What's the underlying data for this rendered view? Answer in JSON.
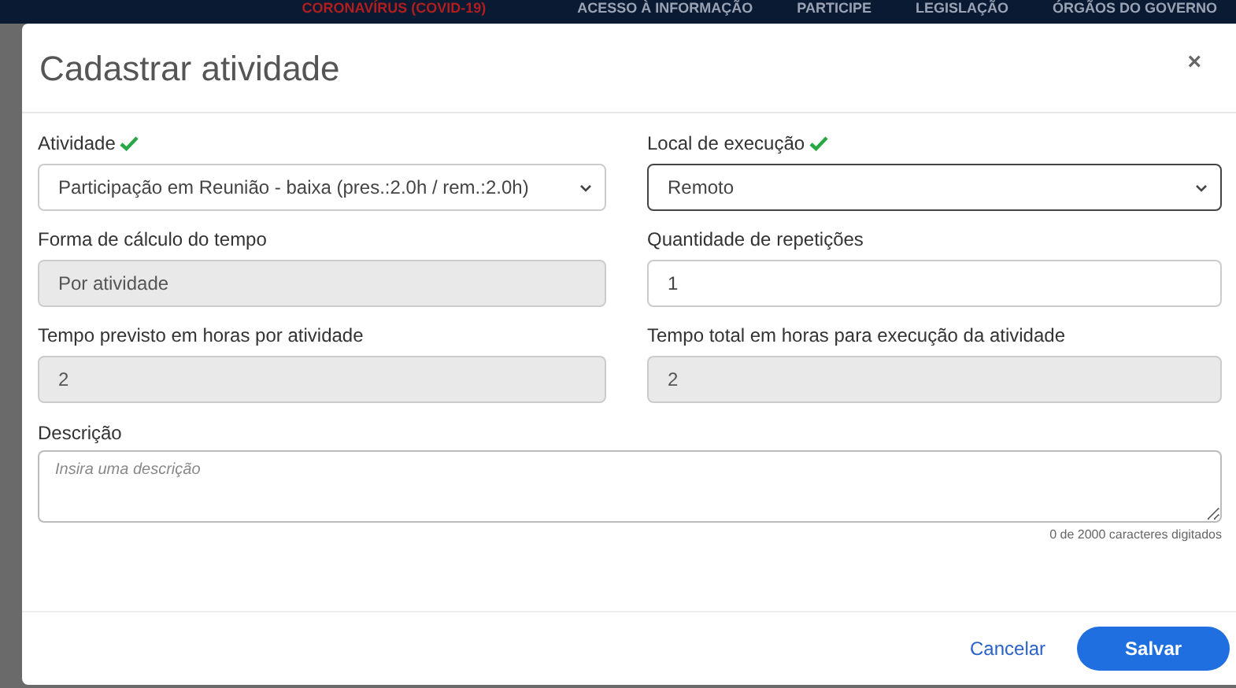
{
  "top_bar": {
    "links": [
      {
        "label": "CORONAVÍRUS (COVID-19)",
        "kind": "alert"
      },
      {
        "label": "ACESSO À INFORMAÇÃO",
        "kind": "normal"
      },
      {
        "label": "PARTICIPE",
        "kind": "normal"
      },
      {
        "label": "LEGISLAÇÃO",
        "kind": "normal"
      },
      {
        "label": "ÓRGÃOS DO GOVERNO",
        "kind": "normal"
      }
    ]
  },
  "dialog": {
    "title": "Cadastrar atividade",
    "close": "×",
    "fields": [
      {
        "kind": "select",
        "label": "Atividade",
        "valid": true,
        "value": "Participação em Reunião - baixa (pres.:2.0h / rem.:2.0h)",
        "disabled": false,
        "focused": false
      },
      {
        "kind": "select",
        "label": "Local de execução",
        "valid": true,
        "value": "Remoto",
        "disabled": false,
        "focused": true
      },
      {
        "kind": "input",
        "label": "Forma de cálculo do tempo",
        "valid": false,
        "value": "Por atividade",
        "disabled": true,
        "focused": false
      },
      {
        "kind": "input",
        "label": "Quantidade de repetições",
        "valid": false,
        "value": "1",
        "disabled": false,
        "focused": false
      },
      {
        "kind": "input",
        "label": "Tempo previsto em horas por atividade",
        "valid": false,
        "value": "2",
        "disabled": true,
        "focused": false
      },
      {
        "kind": "input",
        "label": "Tempo total em horas para execução da atividade",
        "valid": false,
        "value": "2",
        "disabled": true,
        "focused": false
      }
    ],
    "description": {
      "label": "Descrição",
      "placeholder": "Insira uma descrição",
      "counter": "0 de 2000 caracteres digitados"
    },
    "buttons": [
      {
        "label": "Cancelar",
        "kind": "link"
      },
      {
        "label": "Salvar",
        "kind": "primary"
      }
    ]
  }
}
